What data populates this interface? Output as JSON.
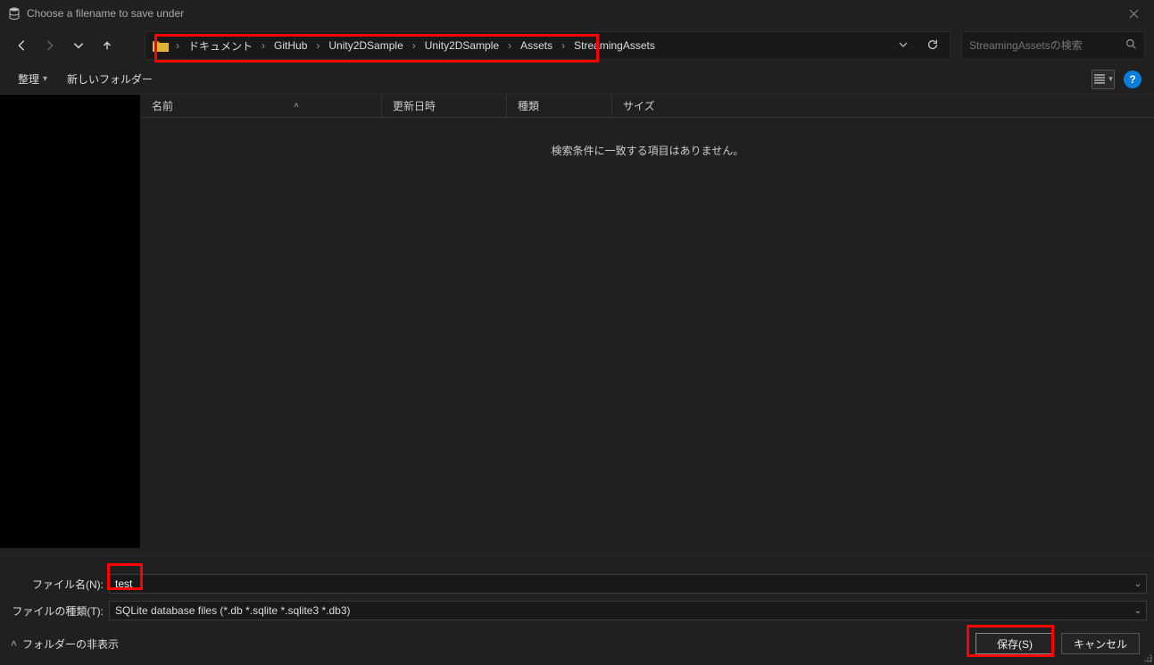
{
  "window": {
    "title": "Choose a filename to save under"
  },
  "breadcrumbs": [
    "ドキュメント",
    "GitHub",
    "Unity2DSample",
    "Unity2DSample",
    "Assets",
    "StreamingAssets"
  ],
  "search": {
    "placeholder": "StreamingAssetsの検索"
  },
  "toolbar": {
    "organize": "整理",
    "new_folder": "新しいフォルダー"
  },
  "columns": {
    "name": "名前",
    "date": "更新日時",
    "type": "種類",
    "size": "サイズ"
  },
  "list": {
    "empty_message": "検索条件に一致する項目はありません。"
  },
  "form": {
    "filename_label": "ファイル名(N):",
    "filename_value": "test",
    "filetype_label": "ファイルの種類(T):",
    "filetype_value": "SQLite database files (*.db *.sqlite *.sqlite3 *.db3)"
  },
  "footer": {
    "hide_folders": "フォルダーの非表示",
    "save": "保存(S)",
    "cancel": "キャンセル"
  }
}
